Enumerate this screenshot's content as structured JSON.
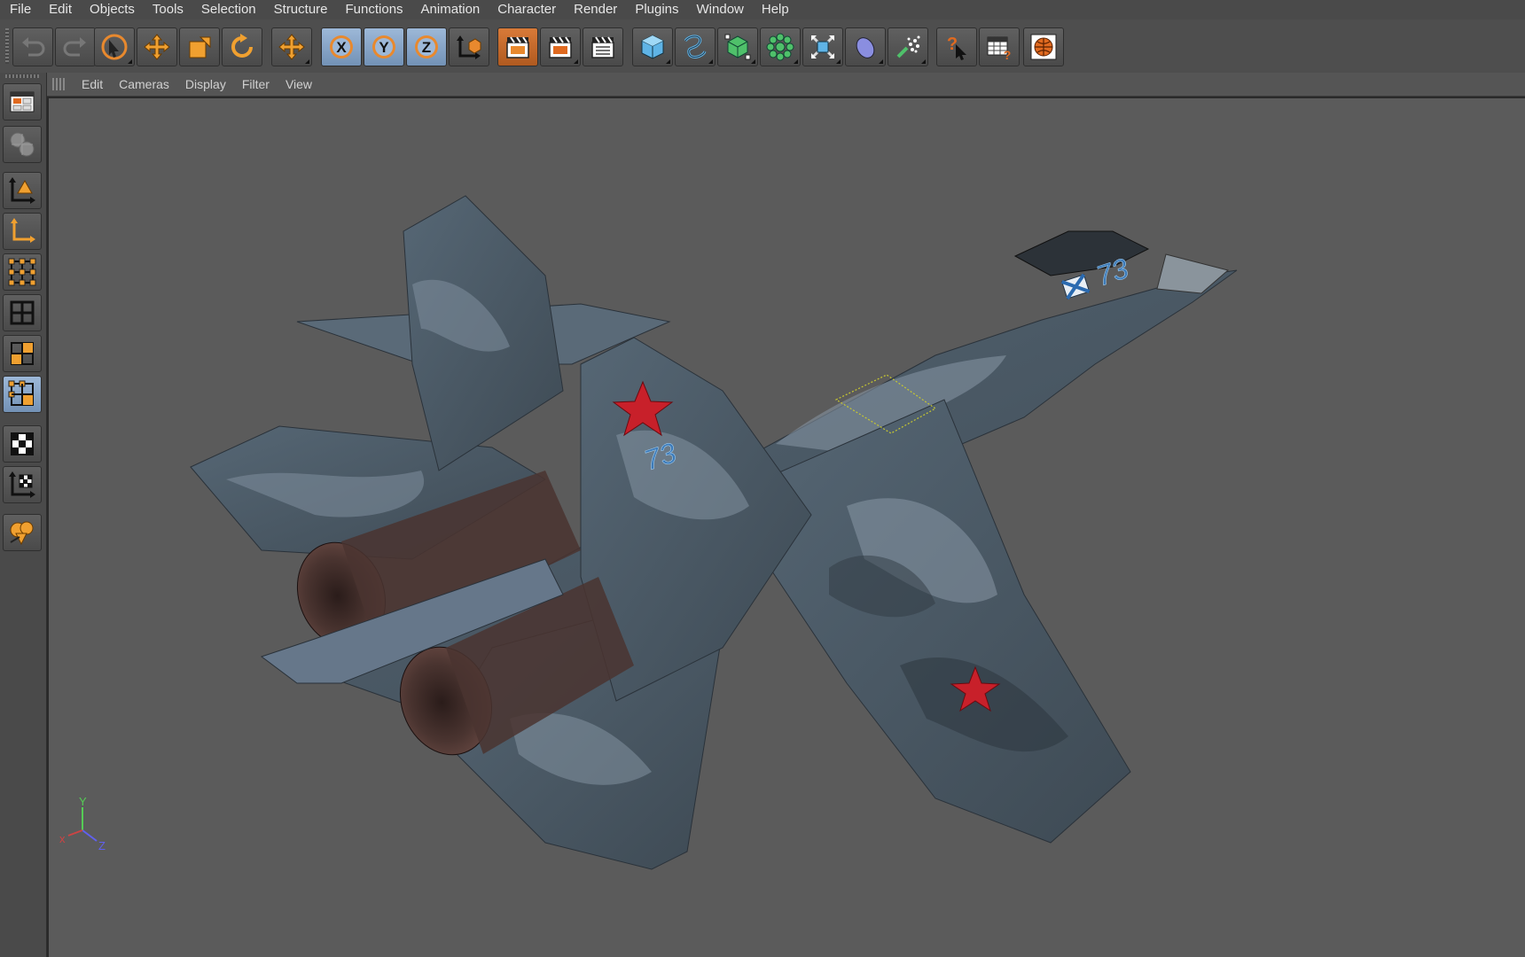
{
  "menu": [
    "File",
    "Edit",
    "Objects",
    "Tools",
    "Selection",
    "Structure",
    "Functions",
    "Animation",
    "Character",
    "Render",
    "Plugins",
    "Window",
    "Help"
  ],
  "toolbar": {
    "history": [
      "undo-icon",
      "redo-icon"
    ],
    "transform": [
      "live-selection-icon",
      "move-icon",
      "scale-icon",
      "rotate-icon",
      "last-tool-icon"
    ],
    "axis": [
      "X",
      "Y",
      "Z"
    ],
    "coord": "world-coordinate-icon",
    "render": [
      "render-view-icon",
      "render-picture-viewer-icon",
      "render-settings-icon"
    ],
    "create": [
      "cube-icon",
      "spline-icon",
      "nurbs-icon",
      "array-icon",
      "deformer-icon",
      "scene-icon",
      "particle-icon"
    ],
    "help": [
      "help-icon",
      "layout-icon",
      "web-icon"
    ]
  },
  "sidebar": [
    "viewport-layout-icon",
    "texture-icon",
    "model-icon",
    "object-axis-icon",
    "points-icon",
    "edges-icon",
    "polygons-icon",
    "polygon-select-icon",
    "texture-mode-icon",
    "workplane-icon",
    "snap-icon"
  ],
  "viewport": {
    "menu": [
      "Edit",
      "Cameras",
      "Display",
      "Filter",
      "View"
    ],
    "axis_labels": {
      "x": "x",
      "y": "Y",
      "z": "Z"
    },
    "aircraft_number": "73",
    "accent_colors": {
      "star": "#c8202a",
      "camo_dark": "#3a4650",
      "camo_light": "#8898a6",
      "nozzle": "#4a3430"
    }
  }
}
